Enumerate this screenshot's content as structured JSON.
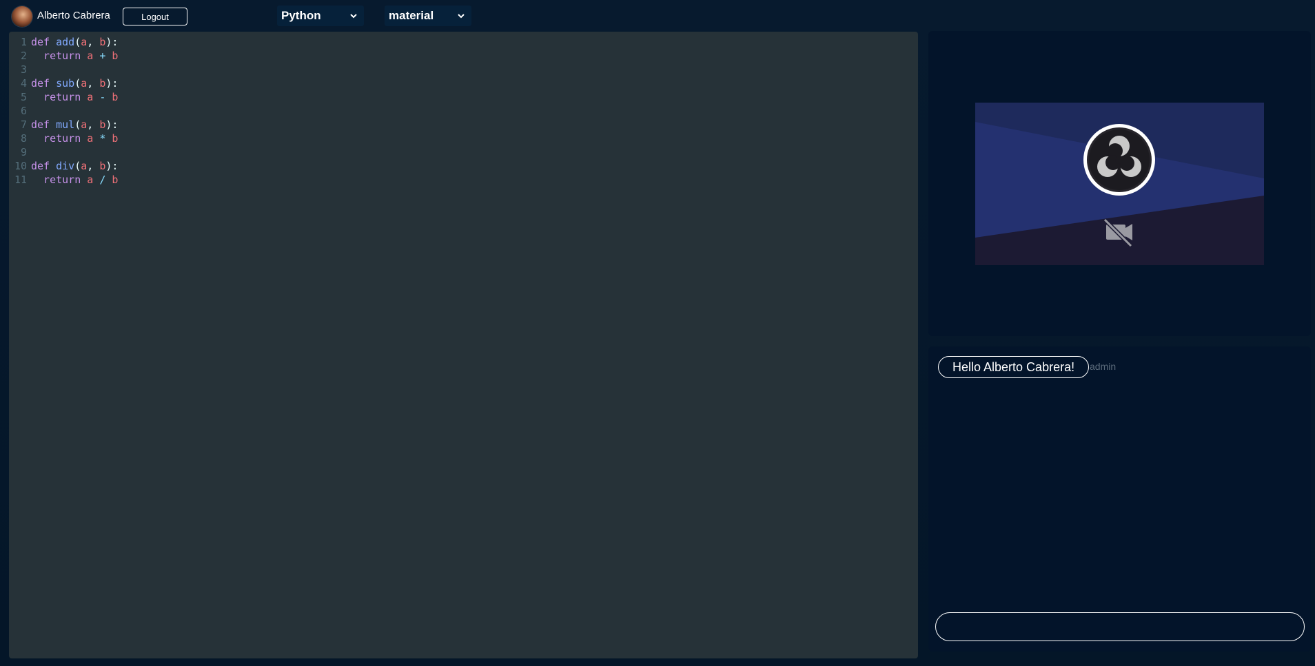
{
  "header": {
    "username": "Alberto Cabrera",
    "logout_label": "Logout",
    "language_select": {
      "selected": "Python"
    },
    "theme_select": {
      "selected": "material"
    }
  },
  "editor": {
    "lines": [
      {
        "num": "1",
        "tokens": [
          [
            "kw",
            "def "
          ],
          [
            "fn",
            "add"
          ],
          [
            "pn",
            "("
          ],
          [
            "var",
            "a"
          ],
          [
            "pn",
            ", "
          ],
          [
            "var",
            "b"
          ],
          [
            "pn",
            "):"
          ]
        ]
      },
      {
        "num": "2",
        "tokens": [
          [
            "kw",
            "  return "
          ],
          [
            "var",
            "a"
          ],
          [
            "op",
            " + "
          ],
          [
            "var",
            "b"
          ]
        ]
      },
      {
        "num": "3",
        "tokens": []
      },
      {
        "num": "4",
        "tokens": [
          [
            "kw",
            "def "
          ],
          [
            "fn",
            "sub"
          ],
          [
            "pn",
            "("
          ],
          [
            "var",
            "a"
          ],
          [
            "pn",
            ", "
          ],
          [
            "var",
            "b"
          ],
          [
            "pn",
            "):"
          ]
        ]
      },
      {
        "num": "5",
        "tokens": [
          [
            "kw",
            "  return "
          ],
          [
            "var",
            "a"
          ],
          [
            "op",
            " - "
          ],
          [
            "var",
            "b"
          ]
        ]
      },
      {
        "num": "6",
        "tokens": []
      },
      {
        "num": "7",
        "tokens": [
          [
            "kw",
            "def "
          ],
          [
            "fn",
            "mul"
          ],
          [
            "pn",
            "("
          ],
          [
            "var",
            "a"
          ],
          [
            "pn",
            ", "
          ],
          [
            "var",
            "b"
          ],
          [
            "pn",
            "):"
          ]
        ]
      },
      {
        "num": "8",
        "tokens": [
          [
            "kw",
            "  return "
          ],
          [
            "var",
            "a"
          ],
          [
            "op",
            " * "
          ],
          [
            "var",
            "b"
          ]
        ]
      },
      {
        "num": "9",
        "tokens": []
      },
      {
        "num": "10",
        "tokens": [
          [
            "kw",
            "def "
          ],
          [
            "fn",
            "div"
          ],
          [
            "pn",
            "("
          ],
          [
            "var",
            "a"
          ],
          [
            "pn",
            ", "
          ],
          [
            "var",
            "b"
          ],
          [
            "pn",
            "):"
          ]
        ]
      },
      {
        "num": "11",
        "tokens": [
          [
            "kw",
            "  return "
          ],
          [
            "var",
            "a"
          ],
          [
            "op",
            " / "
          ],
          [
            "var",
            "b"
          ]
        ]
      }
    ]
  },
  "video": {
    "logo_icon": "obs-logo-icon",
    "status_icon": "video-off-icon"
  },
  "chat": {
    "messages": [
      {
        "text": "Hello Alberto Cabrera!",
        "author": "admin"
      }
    ],
    "input": {
      "value": "",
      "placeholder": ""
    }
  },
  "colors": {
    "background": "#041628",
    "editor_bg": "#263238",
    "panel_bg": "#03142a",
    "keyword": "#c792ea",
    "function": "#82aaff",
    "variable": "#f07178",
    "operator": "#89ddff"
  }
}
